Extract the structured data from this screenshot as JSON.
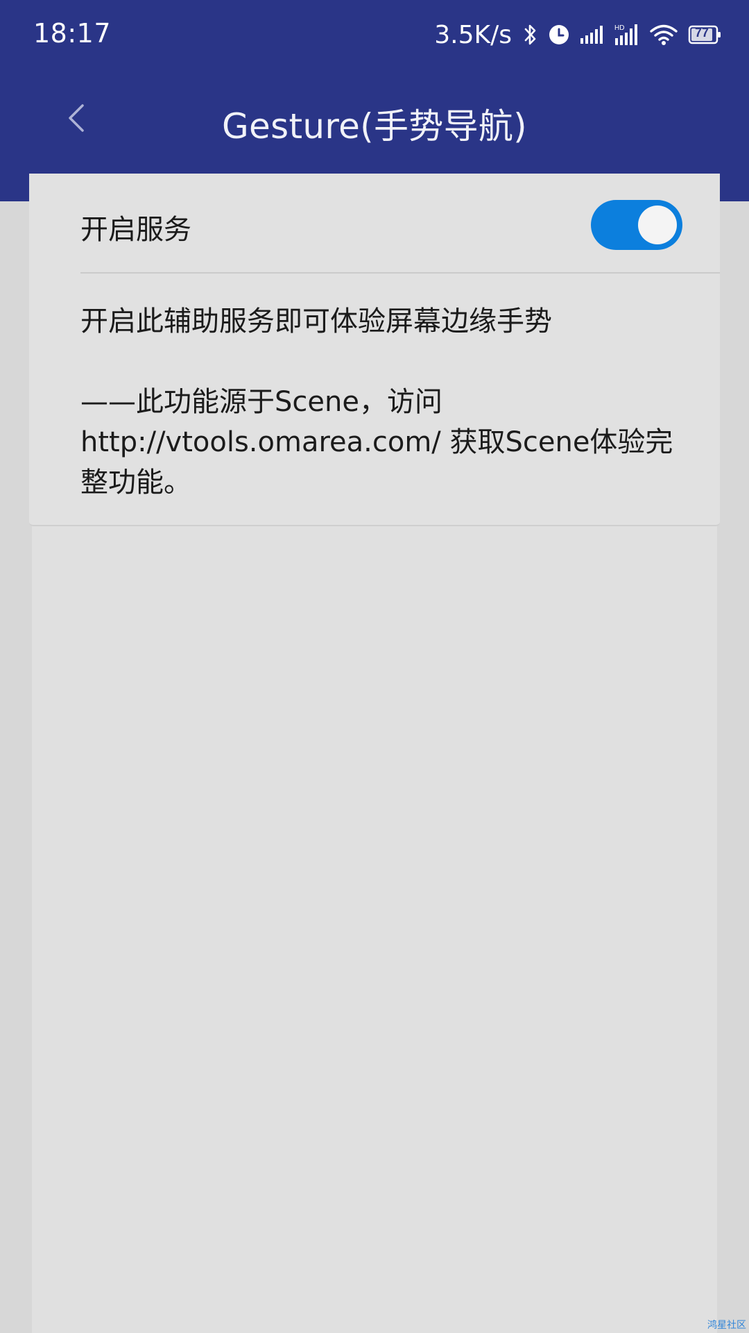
{
  "status_bar": {
    "time": "18:17",
    "net_speed": "3.5K/s",
    "battery": "77",
    "icons": [
      "bluetooth-icon",
      "clock-icon",
      "signal-icon",
      "hd-signal-icon",
      "wifi-icon",
      "battery-icon"
    ]
  },
  "app_bar": {
    "title": "Gesture(手势导航)",
    "back_icon": "chevron-left-icon"
  },
  "card": {
    "enable_label": "开启服务",
    "toggle_on": true,
    "description_1": "开启此辅助服务即可体验屏幕边缘手势",
    "description_2": "——此功能源于Scene，访问 http://vtools.omarea.com/ 获取Scene体验完整功能。"
  },
  "watermark": "鸿星社区",
  "colors": {
    "header": "#2a3587",
    "toggle_on": "#0c7fdd",
    "card": "#e1e1e1",
    "background": "#d7d7d7"
  }
}
